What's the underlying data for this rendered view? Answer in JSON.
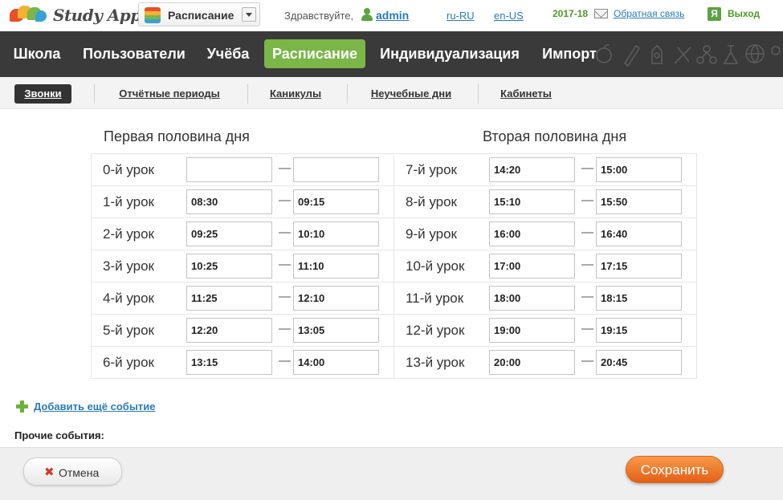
{
  "app": {
    "brand": "Study Apps",
    "module": "Расписание"
  },
  "user": {
    "greeting": "Здравствуйте,",
    "name": "admin"
  },
  "topbar": {
    "lang_ru": "ru-RU",
    "lang_en": "en-US",
    "year": "2017-18",
    "feedback": "Обратная связь",
    "exit_icon_glyph": "Я",
    "exit": "Выход"
  },
  "main_nav": [
    {
      "label": "Школа",
      "active": false
    },
    {
      "label": "Пользователи",
      "active": false
    },
    {
      "label": "Учёба",
      "active": false
    },
    {
      "label": "Расписание",
      "active": true
    },
    {
      "label": "Индивидуализация",
      "active": false
    },
    {
      "label": "Импорт",
      "active": false
    }
  ],
  "sub_nav": [
    {
      "label": "Звонки",
      "active": true
    },
    {
      "label": "Отчётные периоды",
      "active": false
    },
    {
      "label": "Каникулы",
      "active": false
    },
    {
      "label": "Неучебные дни",
      "active": false
    },
    {
      "label": "Кабинеты",
      "active": false
    }
  ],
  "schedule": {
    "dash": "—",
    "first_half": {
      "title": "Первая половина дня",
      "lessons": [
        {
          "label": "0-й урок",
          "start": "",
          "end": ""
        },
        {
          "label": "1-й урок",
          "start": "08:30",
          "end": "09:15"
        },
        {
          "label": "2-й урок",
          "start": "09:25",
          "end": "10:10"
        },
        {
          "label": "3-й урок",
          "start": "10:25",
          "end": "11:10"
        },
        {
          "label": "4-й урок",
          "start": "11:25",
          "end": "12:10"
        },
        {
          "label": "5-й урок",
          "start": "12:20",
          "end": "13:05"
        },
        {
          "label": "6-й урок",
          "start": "13:15",
          "end": "14:00"
        }
      ]
    },
    "second_half": {
      "title": "Вторая половина дня",
      "lessons": [
        {
          "label": "7-й урок",
          "start": "14:20",
          "end": "15:00"
        },
        {
          "label": "8-й урок",
          "start": "15:10",
          "end": "15:50"
        },
        {
          "label": "9-й урок",
          "start": "16:00",
          "end": "16:40"
        },
        {
          "label": "10-й урок",
          "start": "17:00",
          "end": "17:15"
        },
        {
          "label": "11-й урок",
          "start": "18:00",
          "end": "18:15"
        },
        {
          "label": "12-й урок",
          "start": "19:00",
          "end": "19:15"
        },
        {
          "label": "13-й урок",
          "start": "20:00",
          "end": "20:45"
        }
      ]
    }
  },
  "events": {
    "add_label": "Добавить ещё событие",
    "other_label": "Прочие события:"
  },
  "footer": {
    "cancel_icon": "✖",
    "cancel_label": "Отмена",
    "save_label": "Сохранить"
  },
  "colors": {
    "accent_green": "#7ab648",
    "nav_bg": "#3a3a3a",
    "link_blue": "#2a7ab8",
    "save_orange": "#e8702a"
  },
  "icons": {
    "logo": "speech-bubbles-logo-icon",
    "module": "calendar-grid-icon",
    "user": "user-icon",
    "feedback": "mail-icon",
    "exit": "exit-door-icon",
    "add": "plus-icon",
    "cancel": "close-icon"
  }
}
